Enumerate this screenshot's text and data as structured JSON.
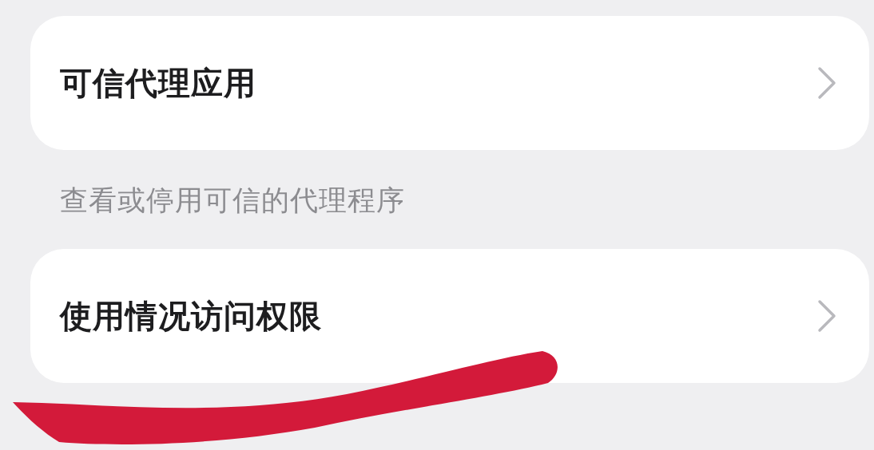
{
  "items": [
    {
      "kind": "link",
      "title": "可信代理应用"
    },
    {
      "kind": "caption",
      "text": "查看或停用可信的代理程序"
    },
    {
      "kind": "link",
      "title": "使用情况访问权限"
    }
  ],
  "annotation": {
    "kind": "stroke"
  }
}
